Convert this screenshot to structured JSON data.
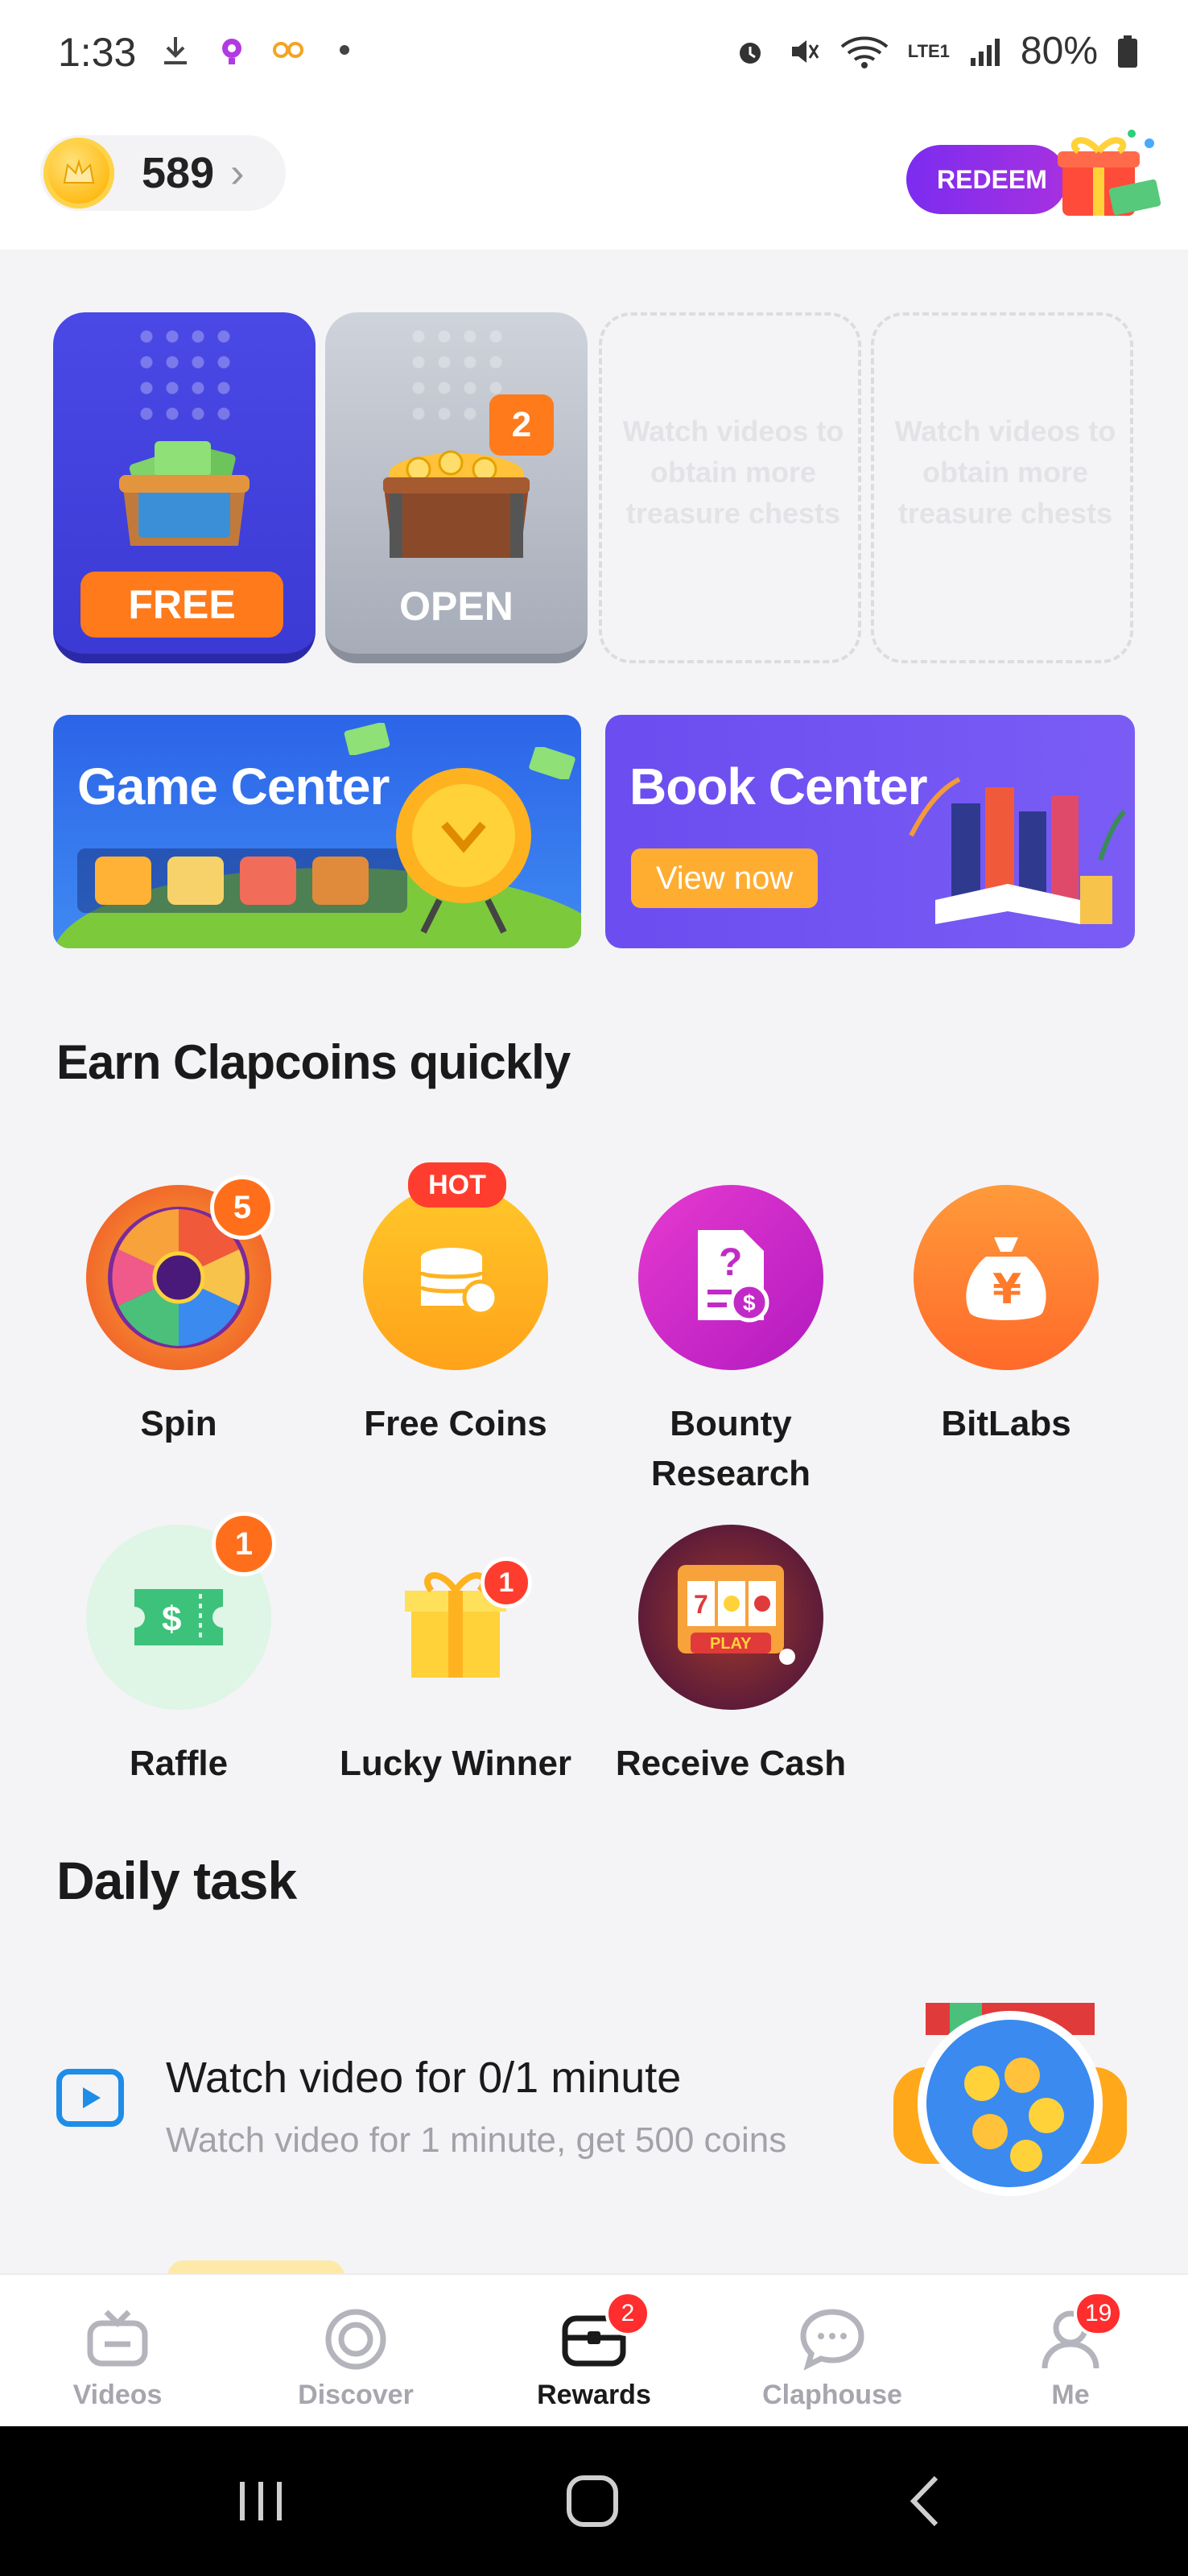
{
  "status_bar": {
    "time": "1:33",
    "battery": "80%",
    "network": "LTE1",
    "icons": [
      "download-icon",
      "app-notification-icon",
      "glasses-icon",
      "dot-icon",
      "alarm-icon",
      "mute-icon",
      "wifi-icon",
      "signal-icon",
      "battery-icon"
    ]
  },
  "header": {
    "coin_balance": "589",
    "redeem_label": "REDEEM"
  },
  "chests": [
    {
      "button_label": "FREE",
      "state": "free"
    },
    {
      "button_label": "OPEN",
      "badge": "2",
      "state": "open"
    },
    {
      "hint": "Watch videos to obtain more treasure chests",
      "state": "empty"
    },
    {
      "hint": "Watch videos to obtain more treasure chests",
      "state": "empty"
    }
  ],
  "banners": {
    "game_center": {
      "title": "Game Center"
    },
    "book_center": {
      "title": "Book Center",
      "cta": "View now"
    }
  },
  "earn_section": {
    "title": "Earn Clapcoins quickly",
    "items": [
      {
        "label": "Spin",
        "badge": "5",
        "icon": "spin-wheel-icon"
      },
      {
        "label": "Free Coins",
        "tag": "HOT",
        "icon": "coin-stack-icon"
      },
      {
        "label": "Bounty Research",
        "icon": "research-document-icon"
      },
      {
        "label": "BitLabs",
        "icon": "money-bag-icon"
      },
      {
        "label": "Raffle",
        "badge": "1",
        "icon": "ticket-icon"
      },
      {
        "label": "Lucky Winner",
        "badge": "1",
        "icon": "gift-box-icon"
      },
      {
        "label": "Receive Cash",
        "icon": "slot-machine-icon",
        "art_text": "PLAY"
      }
    ]
  },
  "daily_task": {
    "title": "Daily task",
    "task": {
      "title": "Watch video for 0/1 minute",
      "subtitle": "Watch video for 1 minute, get 500 coins"
    }
  },
  "bottom_nav": {
    "items": [
      {
        "label": "Videos",
        "icon": "tv-icon",
        "active": false
      },
      {
        "label": "Discover",
        "icon": "discover-icon",
        "active": false
      },
      {
        "label": "Rewards",
        "icon": "rewards-chest-icon",
        "active": true,
        "badge": "2"
      },
      {
        "label": "Claphouse",
        "icon": "chat-bubble-icon",
        "active": false
      },
      {
        "label": "Me",
        "icon": "profile-icon",
        "active": false,
        "badge": "19"
      }
    ]
  },
  "colors": {
    "accent_orange": "#ff7a1b",
    "redeem_purple": "#8a2ee8",
    "badge_red": "#ff2d2d",
    "play_blue": "#1e8de8"
  }
}
